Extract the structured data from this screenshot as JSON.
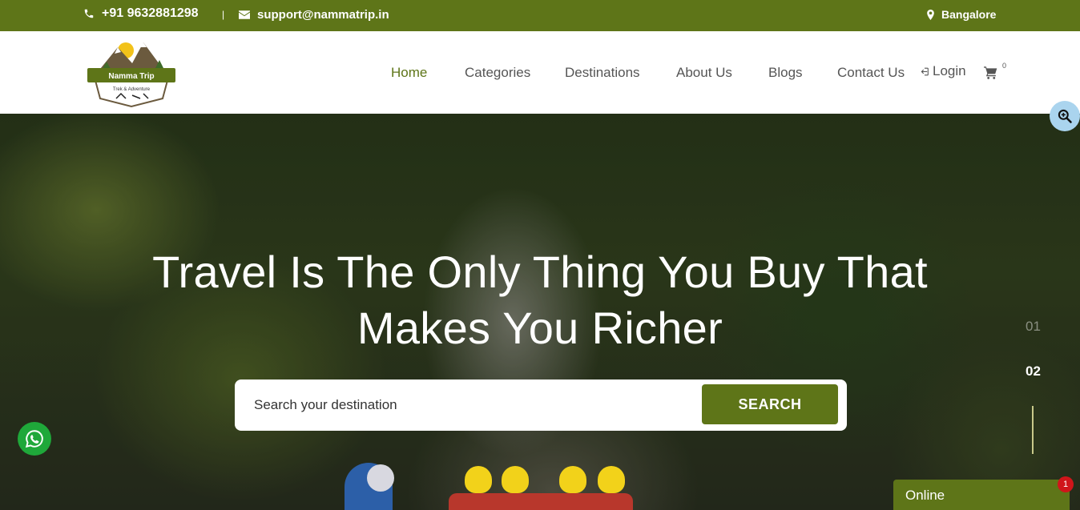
{
  "topbar": {
    "phone": "+91 9632881298",
    "separator": "|",
    "email": "support@nammatrip.in",
    "location": "Bangalore",
    "phone_icon": "phone-icon",
    "email_icon": "envelope-icon",
    "location_icon": "map-marker-icon",
    "background_color": "#5e7518"
  },
  "logo": {
    "title": "Namma Trip",
    "subtitle": "Trek & Adventure"
  },
  "nav": {
    "items": [
      {
        "label": "Home",
        "active": true
      },
      {
        "label": "Categories",
        "active": false
      },
      {
        "label": "Destinations",
        "active": false
      },
      {
        "label": "About Us",
        "active": false
      },
      {
        "label": "Blogs",
        "active": false
      },
      {
        "label": "Contact Us",
        "active": false
      }
    ],
    "login_label": "Login",
    "cart_count": "0"
  },
  "hero": {
    "headline_line1": "Travel Is The Only Thing You Buy That",
    "headline_line2": "Makes You Richer",
    "search_placeholder": "Search your destination",
    "search_button": "SEARCH",
    "slide_indicators": [
      "01",
      "02"
    ],
    "active_slide": "02"
  },
  "chat": {
    "status": "Online",
    "unread": "1"
  },
  "colors": {
    "brand": "#5e7518",
    "whatsapp": "#1fa83a",
    "badge": "#d0151a"
  }
}
